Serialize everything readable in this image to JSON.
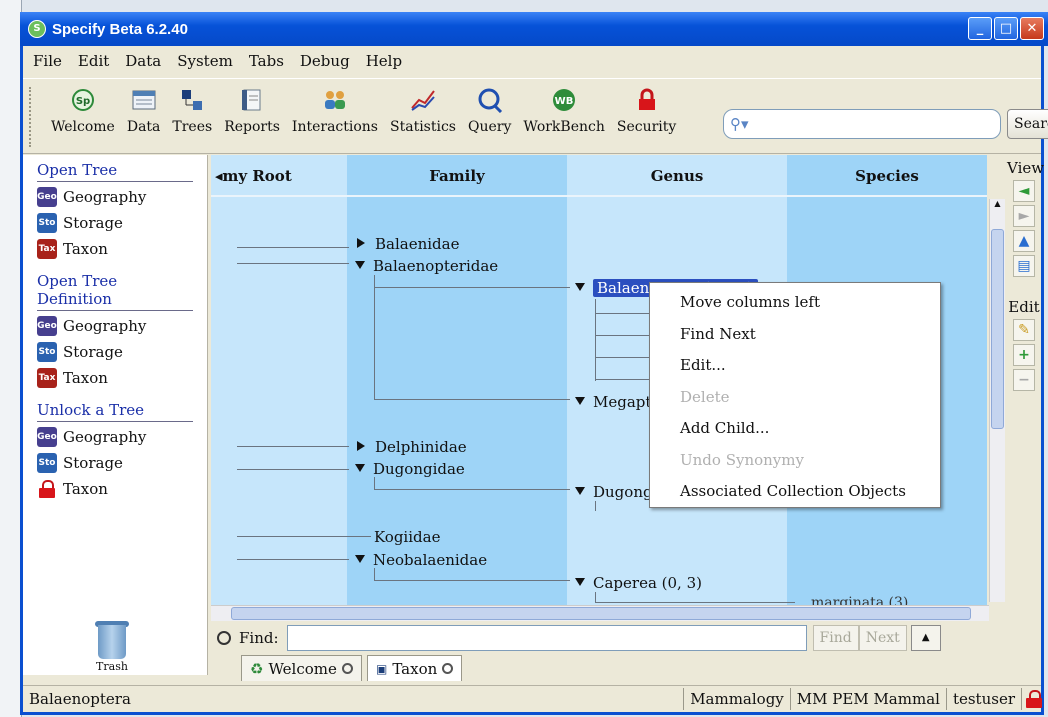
{
  "window": {
    "title": "Specify Beta 6.2.40",
    "controls": [
      "_",
      "□",
      "✕"
    ]
  },
  "menu": [
    "File",
    "Edit",
    "Data",
    "System",
    "Tabs",
    "Debug",
    "Help"
  ],
  "toolbar": {
    "items": [
      {
        "label": "Welcome",
        "icon": "welcome-icon"
      },
      {
        "label": "Data",
        "icon": "data-icon"
      },
      {
        "label": "Trees",
        "icon": "trees-icon"
      },
      {
        "label": "Reports",
        "icon": "reports-icon"
      },
      {
        "label": "Interactions",
        "icon": "interactions-icon"
      },
      {
        "label": "Statistics",
        "icon": "statistics-icon"
      },
      {
        "label": "Query",
        "icon": "query-icon"
      },
      {
        "label": "WorkBench",
        "icon": "workbench-icon"
      },
      {
        "label": "Security",
        "icon": "security-icon"
      }
    ],
    "search_button": "Search"
  },
  "sidepanel": {
    "sections": [
      {
        "heading": "Open Tree",
        "items": [
          {
            "label": "Geography",
            "badge": "Geo",
            "kind": "geo"
          },
          {
            "label": "Storage",
            "badge": "Sto",
            "kind": "sto"
          },
          {
            "label": "Taxon",
            "badge": "Tax",
            "kind": "tax"
          }
        ]
      },
      {
        "heading": "Open Tree Definition",
        "items": [
          {
            "label": "Geography",
            "badge": "Geo",
            "kind": "geo"
          },
          {
            "label": "Storage",
            "badge": "Sto",
            "kind": "sto"
          },
          {
            "label": "Taxon",
            "badge": "Tax",
            "kind": "tax"
          }
        ]
      },
      {
        "heading": "Unlock a Tree",
        "items": [
          {
            "label": "Geography",
            "badge": "Geo",
            "kind": "geo"
          },
          {
            "label": "Storage",
            "badge": "Sto",
            "kind": "sto"
          },
          {
            "label": "Taxon",
            "badge": "",
            "kind": "lock"
          }
        ]
      }
    ],
    "trash_label": "Trash"
  },
  "tree": {
    "columns": [
      "my Root",
      "Family",
      "Genus",
      "Species"
    ],
    "column_colors": [
      "#c6e6fb",
      "#9ed4f7",
      "#c6e6fb",
      "#9ed4f7"
    ],
    "family_nodes": [
      "Balaenidae",
      "Balaenopteridae",
      "Delphinidae",
      "Dugongidae",
      "Kogiidae",
      "Neobalaenidae"
    ],
    "genus_nodes": [
      "Balaenoptera (0, 33)",
      "Megaptera",
      "Dugong (0",
      "Caperea (0, 3)"
    ],
    "species_nodes": [
      "marginata (3)"
    ]
  },
  "rstrip": {
    "view_label": "View",
    "edit_label": "Edit"
  },
  "findbar": {
    "label": "Find:",
    "find_button": "Find",
    "next_button": "Next"
  },
  "tabs": [
    {
      "label": "Welcome"
    },
    {
      "label": "Taxon"
    }
  ],
  "status": {
    "left": "Balaenoptera",
    "discipline": "Mammalogy",
    "collection": "MM PEM Mammal",
    "user": "testuser"
  },
  "context_menu": {
    "items": [
      {
        "label": "Move columns left",
        "enabled": true
      },
      {
        "label": "Find Next",
        "enabled": true
      },
      {
        "label": "Edit...",
        "enabled": true
      },
      {
        "label": "Delete",
        "enabled": false
      },
      {
        "label": "Add Child...",
        "enabled": true
      },
      {
        "label": "Undo Synonymy",
        "enabled": false
      },
      {
        "label": "Associated Collection Objects",
        "enabled": true
      }
    ]
  }
}
